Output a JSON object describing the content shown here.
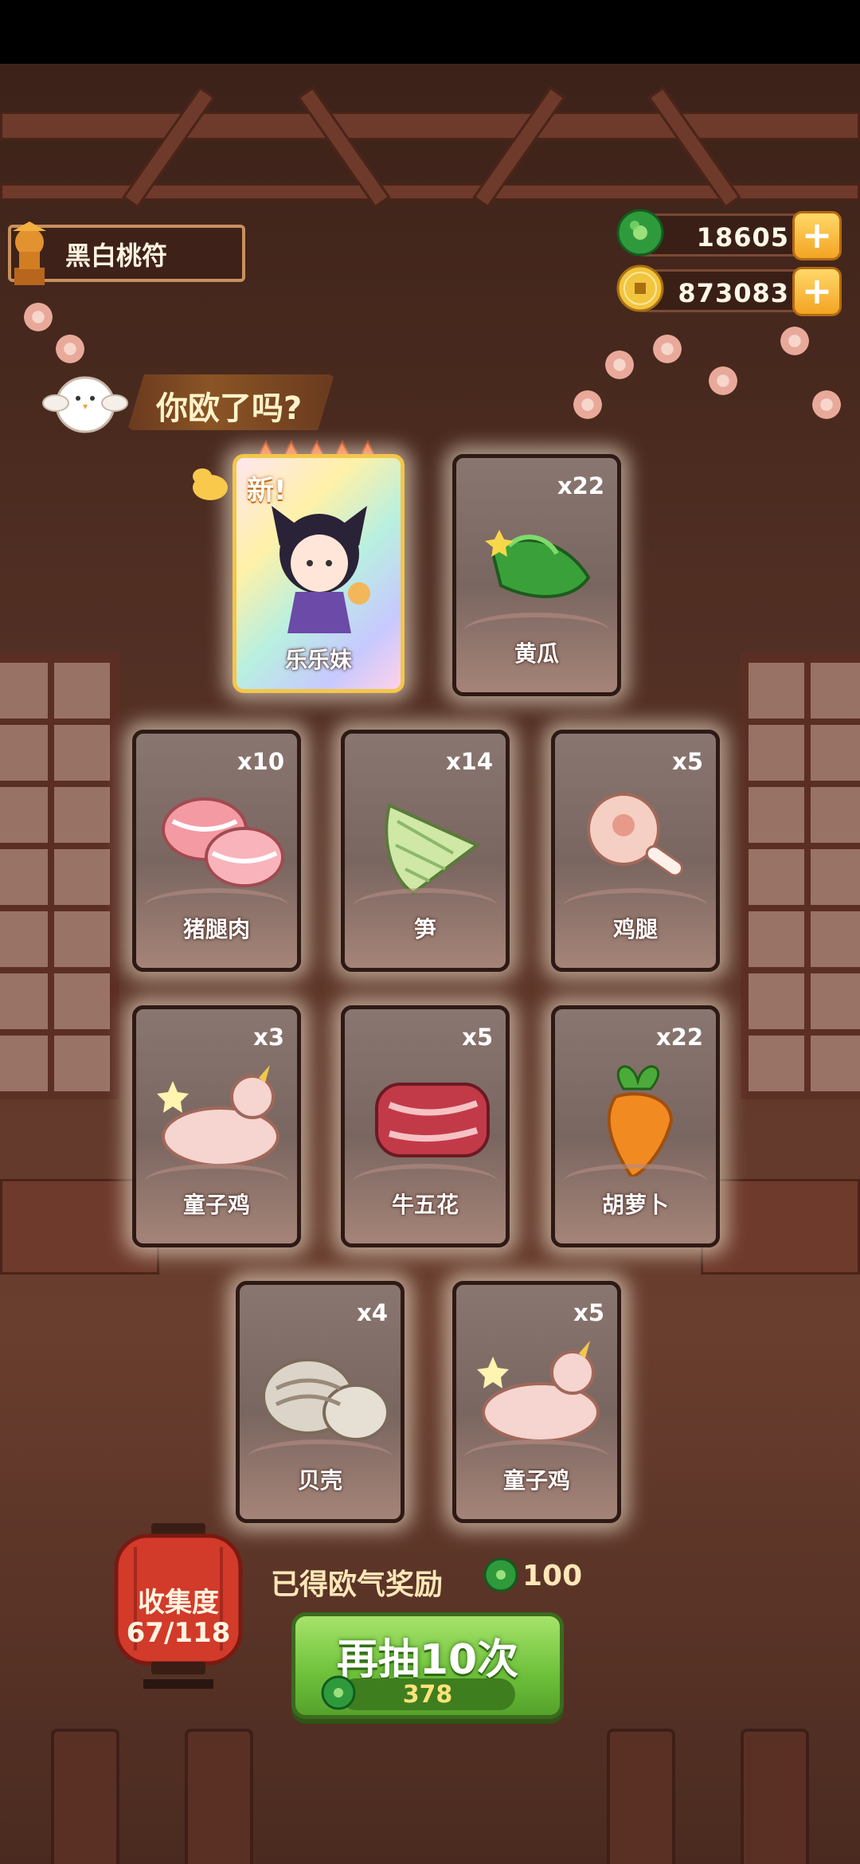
{
  "player": {
    "name": "黑白桃符"
  },
  "currency": {
    "jade": {
      "value": "18605",
      "icon": "jade-coin-icon"
    },
    "coins": {
      "value": "873083",
      "icon": "gold-coin-icon"
    }
  },
  "banner": {
    "text": "你欧了吗?"
  },
  "hero_card": {
    "label": "乐乐妹",
    "new_tag": "新!",
    "stars": 5
  },
  "cards": [
    {
      "name": "cucumber",
      "label": "黄瓜",
      "qty": "x22"
    },
    {
      "name": "pork-leg",
      "label": "猪腿肉",
      "qty": "x10"
    },
    {
      "name": "bamboo-shoot",
      "label": "笋",
      "qty": "x14"
    },
    {
      "name": "chicken-leg",
      "label": "鸡腿",
      "qty": "x5"
    },
    {
      "name": "young-chicken",
      "label": "童子鸡",
      "qty": "x3"
    },
    {
      "name": "beef-belly",
      "label": "牛五花",
      "qty": "x5"
    },
    {
      "name": "carrot",
      "label": "胡萝卜",
      "qty": "x22"
    },
    {
      "name": "shell",
      "label": "贝壳",
      "qty": "x4"
    },
    {
      "name": "young-chicken-2",
      "label": "童子鸡",
      "qty": "x5"
    }
  ],
  "collection": {
    "label": "收集度",
    "progress": "67/118"
  },
  "reward": {
    "label": "已得欧气奖励",
    "value": "100"
  },
  "draw_button": {
    "label": "再抽10次",
    "cost": "378"
  },
  "colors": {
    "accent_green": "#6dc03a",
    "gold": "#f3a423",
    "card_border": "#2e1a14"
  }
}
